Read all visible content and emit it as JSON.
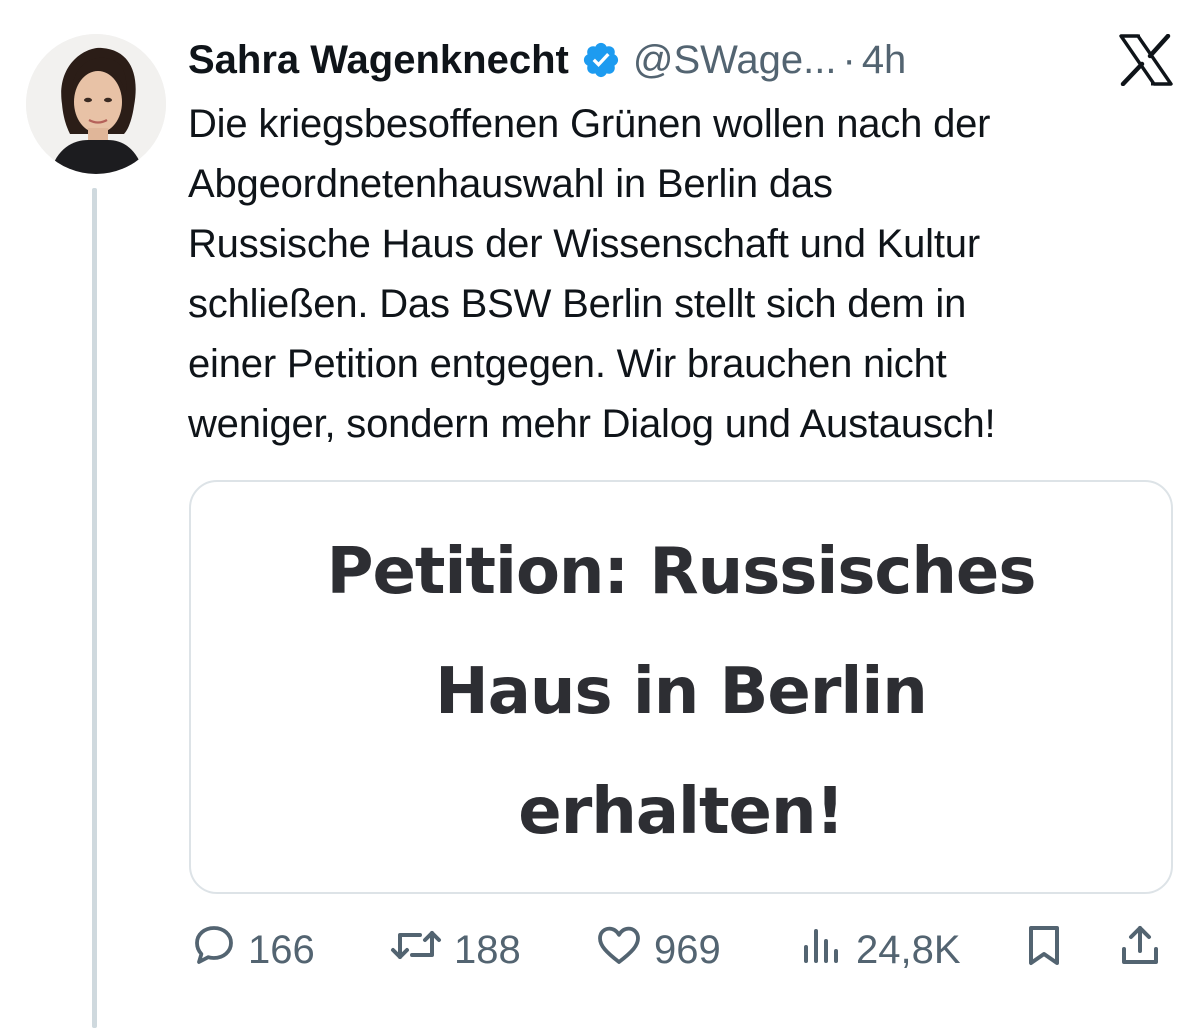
{
  "author": {
    "name": "Sahra Wagenknecht",
    "handle": "@SWage...",
    "separator": "·",
    "time": "4h"
  },
  "icons": {
    "verified": "verified-badge-icon",
    "platform": "x-logo-icon"
  },
  "colors": {
    "verified_blue": "#1d9bf0",
    "text_primary": "#0f1419",
    "text_secondary": "#536471",
    "border": "#cfd9de"
  },
  "tweet": {
    "text": "Die kriegsbesoffenen Grünen wollen nach der\nAbgeordnetenhauswahl in Berlin das\nRussische Haus der Wissenschaft und Kultur\nschließen. Das BSW Berlin stellt sich dem in\neiner Petition entgegen. Wir brauchen nicht\nweniger, sondern mehr Dialog und Austausch!"
  },
  "card": {
    "title": "Petition: Russisches\nHaus in Berlin\nerhalten!"
  },
  "metrics": {
    "replies": "166",
    "reposts": "188",
    "likes": "969",
    "views": "24,8K"
  }
}
